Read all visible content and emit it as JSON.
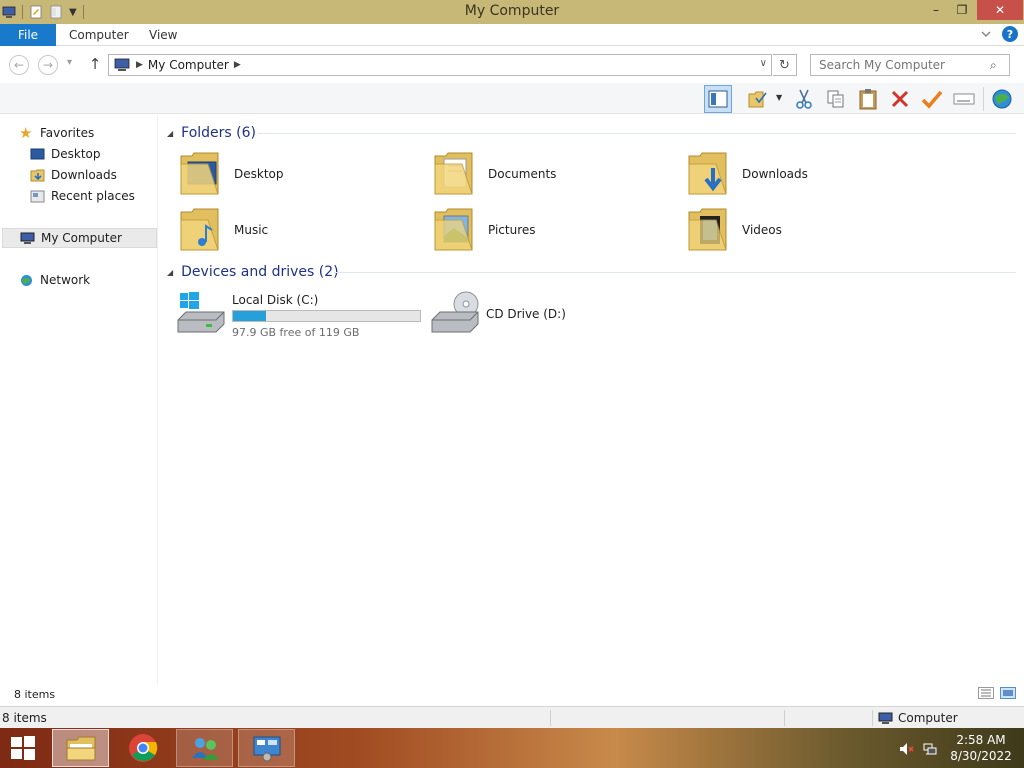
{
  "window": {
    "title": "My Computer",
    "minimize": "–",
    "maximize": "❐",
    "close": "✕"
  },
  "ribbon": {
    "tabs": [
      "File",
      "Computer",
      "View"
    ],
    "collapse_icon": "chevron-down-icon",
    "help_icon": "?"
  },
  "address": {
    "back_icon": "←",
    "forward_icon": "→",
    "recent_icon": "▾",
    "up_icon": "↑",
    "crumb_sep": "▶",
    "path": "My Computer",
    "dropdown": "∨",
    "refresh": "↻",
    "search_placeholder": "Search My Computer",
    "search_icon": "⌕"
  },
  "toolbar": {
    "icons": [
      "preview-pane-icon",
      "select-all-icon",
      "cut-icon",
      "copy-icon",
      "paste-icon",
      "delete-icon",
      "check-icon",
      "rename-icon",
      "network-icon"
    ]
  },
  "nav": {
    "favorites": "Favorites",
    "desktop": "Desktop",
    "downloads": "Downloads",
    "recent": "Recent places",
    "computer": "My Computer",
    "network": "Network"
  },
  "folders": {
    "header": "Folders (6)",
    "items": [
      "Desktop",
      "Documents",
      "Downloads",
      "Music",
      "Pictures",
      "Videos"
    ]
  },
  "drives": {
    "header": "Devices and drives (2)",
    "items": [
      {
        "name": "Local Disk (C:)",
        "free_text": "97.9 GB free of 119 GB",
        "used_fraction": 0.177
      },
      {
        "name": "CD Drive (D:)"
      }
    ]
  },
  "status": {
    "item_count": "8 items",
    "bottom_count": "8 items",
    "location": "Computer"
  },
  "taskbar": {
    "time": "2:58 AM",
    "date": "8/30/2022"
  },
  "colors": {
    "titlebar": "#c8b877",
    "file_tab": "#1979ca",
    "group_header": "#1e3287",
    "disk_fill": "#26a0da",
    "close_button": "#c7504b"
  }
}
